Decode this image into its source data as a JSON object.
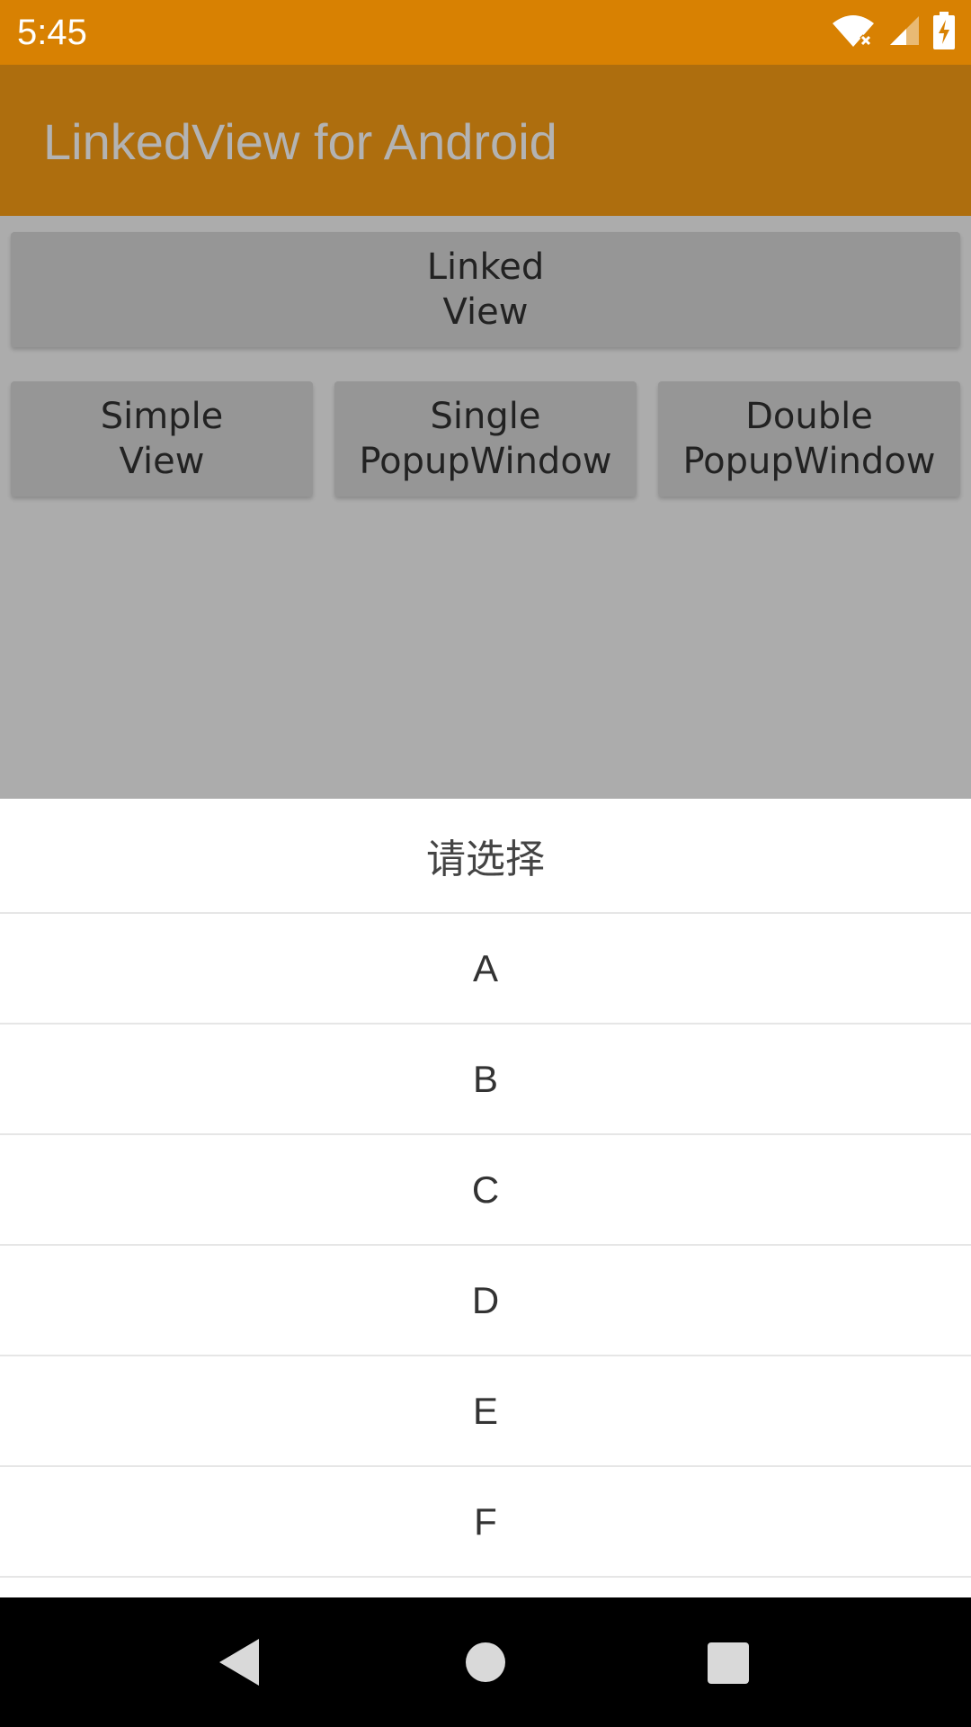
{
  "status_bar": {
    "time": "5:45",
    "icons": [
      "wifi-off-icon",
      "signal-icon",
      "battery-charging-icon"
    ]
  },
  "app_bar": {
    "title": "LinkedView for Android"
  },
  "buttons": {
    "linked_view": "Linked\nView",
    "simple_view": "Simple\nView",
    "single_popup": "Single\nPopupWindow",
    "double_popup": "Double\nPopupWindow"
  },
  "picker": {
    "title": "请选择",
    "items": [
      "A",
      "B",
      "C",
      "D",
      "E",
      "F"
    ]
  },
  "nav_bar": {
    "icons": [
      "back-icon",
      "home-icon",
      "recents-icon"
    ]
  },
  "colors": {
    "status_bar": "#d88102",
    "app_bar": "#ae6e0e",
    "scrim_background": "#acacac",
    "button": "#969696"
  }
}
